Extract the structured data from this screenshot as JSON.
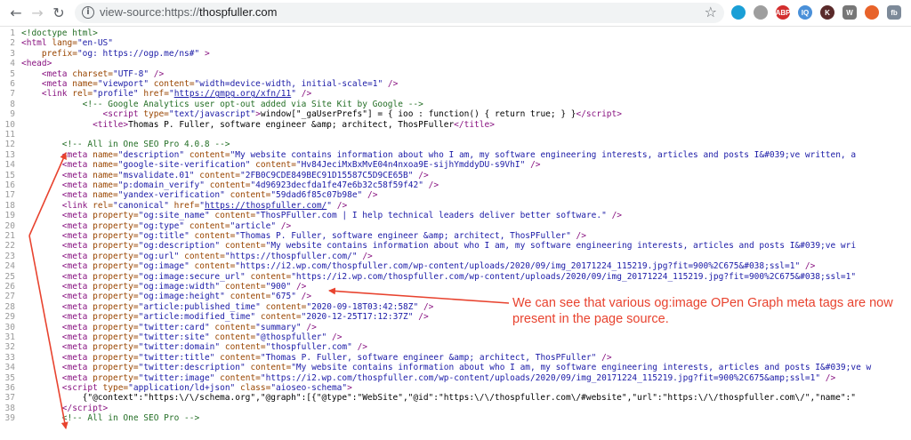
{
  "browser": {
    "url_scheme": "view-source:https://",
    "url_host": "thospfuller.com",
    "back_icon": "arrow-left",
    "forward_icon": "arrow-right",
    "reload_icon": "reload",
    "info_icon": "info-circle",
    "star_icon": "star-outline",
    "extensions": [
      {
        "name": "chat-extension-icon",
        "label": "",
        "color": "#1a9fd6"
      },
      {
        "name": "cloud-extension-icon",
        "label": "",
        "color": "#9e9e9e"
      },
      {
        "name": "adblock-icon",
        "label": "ABP",
        "color": "#d32f2f"
      },
      {
        "name": "iq-extension-icon",
        "label": "IQ",
        "color": "#4a90d9"
      },
      {
        "name": "k-extension-icon",
        "label": "K",
        "color": "#5a2a2a"
      },
      {
        "name": "wordpress-icon",
        "label": "W",
        "color": "#777777"
      },
      {
        "name": "office-icon",
        "label": "",
        "color": "#e8632a"
      },
      {
        "name": "fb-extension-icon",
        "label": "fb",
        "color": "#7d8a99"
      }
    ]
  },
  "source_lines": [
    {
      "n": "1",
      "html": "<span class=\"c\">&lt;!doctype html&gt;</span>"
    },
    {
      "n": "2",
      "html": "<span class=\"t\">&lt;html</span> <span class=\"a\">lang=</span><span class=\"v\">\"en-US\"</span>"
    },
    {
      "n": "3",
      "html": "    <span class=\"a\">prefix=</span><span class=\"v\">\"og: https://ogp.me/ns#\"</span> <span class=\"t\">&gt;</span>"
    },
    {
      "n": "4",
      "html": "<span class=\"t\">&lt;head&gt;</span>"
    },
    {
      "n": "5",
      "html": "    <span class=\"t\">&lt;meta</span> <span class=\"a\">charset=</span><span class=\"v\">\"UTF-8\"</span> <span class=\"t\">/&gt;</span>"
    },
    {
      "n": "6",
      "html": "    <span class=\"t\">&lt;meta</span> <span class=\"a\">name=</span><span class=\"v\">\"viewport\"</span> <span class=\"a\">content=</span><span class=\"v\">\"width=device-width, initial-scale=1\"</span> <span class=\"t\">/&gt;</span>"
    },
    {
      "n": "7",
      "html": "    <span class=\"t\">&lt;link</span> <span class=\"a\">rel=</span><span class=\"v\">\"profile\"</span> <span class=\"a\">href=</span><span class=\"v\">\"<span class=\"lnk\">https://gmpg.org/xfn/11</span>\"</span> <span class=\"t\">/&gt;</span>"
    },
    {
      "n": "8",
      "html": "            <span class=\"c\">&lt;!-- Google Analytics user opt-out added via Site Kit by Google --&gt;</span>"
    },
    {
      "n": "9",
      "html": "                <span class=\"t\">&lt;script</span> <span class=\"a\">type=</span><span class=\"v\">\"text/javascript\"</span><span class=\"t\">&gt;</span>window[\"_gaUserPrefs\"] = { ioo : function() { return true; } }<span class=\"t\">&lt;/script&gt;</span>"
    },
    {
      "n": "10",
      "html": "              <span class=\"t\">&lt;title&gt;</span>Thomas P. Fuller, software engineer &amp;amp; architect, ThosPFuller<span class=\"t\">&lt;/title&gt;</span>"
    },
    {
      "n": "11",
      "html": ""
    },
    {
      "n": "12",
      "html": "        <span class=\"c\">&lt;!-- All in One SEO Pro 4.0.8 --&gt;</span>"
    },
    {
      "n": "13",
      "html": "        <span class=\"t\">&lt;meta</span> <span class=\"a\">name=</span><span class=\"v\">\"description\"</span> <span class=\"a\">content=</span><span class=\"v\">\"My website contains information about who I am, my software engineering interests, articles and posts I&amp;#039;ve written, a</span>"
    },
    {
      "n": "14",
      "html": "        <span class=\"t\">&lt;meta</span> <span class=\"a\">name=</span><span class=\"v\">\"google-site-verification\"</span> <span class=\"a\">content=</span><span class=\"v\">\"Hv84JeciMxBxMvE04n4nxoa9E-sijhYmddyDU-s9VhI\"</span> <span class=\"t\">/&gt;</span>"
    },
    {
      "n": "15",
      "html": "        <span class=\"t\">&lt;meta</span> <span class=\"a\">name=</span><span class=\"v\">\"msvalidate.01\"</span> <span class=\"a\">content=</span><span class=\"v\">\"2FB0C9CDE849BEC91D15587C5D9CE65B\"</span> <span class=\"t\">/&gt;</span>"
    },
    {
      "n": "16",
      "html": "        <span class=\"t\">&lt;meta</span> <span class=\"a\">name=</span><span class=\"v\">\"p:domain_verify\"</span> <span class=\"a\">content=</span><span class=\"v\">\"4d96923decfda1fe47e6b32c58f59f42\"</span> <span class=\"t\">/&gt;</span>"
    },
    {
      "n": "17",
      "html": "        <span class=\"t\">&lt;meta</span> <span class=\"a\">name=</span><span class=\"v\">\"yandex-verification\"</span> <span class=\"a\">content=</span><span class=\"v\">\"59dad6f85c07b98e\"</span> <span class=\"t\">/&gt;</span>"
    },
    {
      "n": "18",
      "html": "        <span class=\"t\">&lt;link</span> <span class=\"a\">rel=</span><span class=\"v\">\"canonical\"</span> <span class=\"a\">href=</span><span class=\"v\">\"<span class=\"lnk\">https://thospfuller.com/</span>\"</span> <span class=\"t\">/&gt;</span>"
    },
    {
      "n": "19",
      "html": "        <span class=\"t\">&lt;meta</span> <span class=\"a\">property=</span><span class=\"v\">\"og:site_name\"</span> <span class=\"a\">content=</span><span class=\"v\">\"ThosPFuller.com | I help technical leaders deliver better software.\"</span> <span class=\"t\">/&gt;</span>"
    },
    {
      "n": "20",
      "html": "        <span class=\"t\">&lt;meta</span> <span class=\"a\">property=</span><span class=\"v\">\"og:type\"</span> <span class=\"a\">content=</span><span class=\"v\">\"article\"</span> <span class=\"t\">/&gt;</span>"
    },
    {
      "n": "21",
      "html": "        <span class=\"t\">&lt;meta</span> <span class=\"a\">property=</span><span class=\"v\">\"og:title\"</span> <span class=\"a\">content=</span><span class=\"v\">\"Thomas P. Fuller, software engineer &amp;amp; architect, ThosPFuller\"</span> <span class=\"t\">/&gt;</span>"
    },
    {
      "n": "22",
      "html": "        <span class=\"t\">&lt;meta</span> <span class=\"a\">property=</span><span class=\"v\">\"og:description\"</span> <span class=\"a\">content=</span><span class=\"v\">\"My website contains information about who I am, my software engineering interests, articles and posts I&amp;#039;ve wri</span>"
    },
    {
      "n": "23",
      "html": "        <span class=\"t\">&lt;meta</span> <span class=\"a\">property=</span><span class=\"v\">\"og:url\"</span> <span class=\"a\">content=</span><span class=\"v\">\"https://thospfuller.com/\"</span> <span class=\"t\">/&gt;</span>"
    },
    {
      "n": "24",
      "html": "        <span class=\"t\">&lt;meta</span> <span class=\"a\">property=</span><span class=\"v\">\"og:image\"</span> <span class=\"a\">content=</span><span class=\"v\">\"https://i2.wp.com/thospfuller.com/wp-content/uploads/2020/09/img_20171224_115219.jpg?fit=900%2C675&amp;#038;ssl=1\"</span> <span class=\"t\">/&gt;</span>"
    },
    {
      "n": "25",
      "html": "        <span class=\"t\">&lt;meta</span> <span class=\"a\">property=</span><span class=\"v\">\"og:image:secure_url\"</span> <span class=\"a\">content=</span><span class=\"v\">\"https://i2.wp.com/thospfuller.com/wp-content/uploads/2020/09/img_20171224_115219.jpg?fit=900%2C675&amp;#038;ssl=1\"</span>"
    },
    {
      "n": "26",
      "html": "        <span class=\"t\">&lt;meta</span> <span class=\"a\">property=</span><span class=\"v\">\"og:image:width\"</span> <span class=\"a\">content=</span><span class=\"v\">\"900\"</span> <span class=\"t\">/&gt;</span>"
    },
    {
      "n": "27",
      "html": "        <span class=\"t\">&lt;meta</span> <span class=\"a\">property=</span><span class=\"v\">\"og:image:height\"</span> <span class=\"a\">content=</span><span class=\"v\">\"675\"</span> <span class=\"t\">/&gt;</span>"
    },
    {
      "n": "28",
      "html": "        <span class=\"t\">&lt;meta</span> <span class=\"a\">property=</span><span class=\"v\">\"article:published_time\"</span> <span class=\"a\">content=</span><span class=\"v\">\"2020-09-18T03:42:58Z\"</span> <span class=\"t\">/&gt;</span>"
    },
    {
      "n": "29",
      "html": "        <span class=\"t\">&lt;meta</span> <span class=\"a\">property=</span><span class=\"v\">\"article:modified_time\"</span> <span class=\"a\">content=</span><span class=\"v\">\"2020-12-25T17:12:37Z\"</span> <span class=\"t\">/&gt;</span>"
    },
    {
      "n": "30",
      "html": "        <span class=\"t\">&lt;meta</span> <span class=\"a\">property=</span><span class=\"v\">\"twitter:card\"</span> <span class=\"a\">content=</span><span class=\"v\">\"summary\"</span> <span class=\"t\">/&gt;</span>"
    },
    {
      "n": "31",
      "html": "        <span class=\"t\">&lt;meta</span> <span class=\"a\">property=</span><span class=\"v\">\"twitter:site\"</span> <span class=\"a\">content=</span><span class=\"v\">\"@thospfuller\"</span> <span class=\"t\">/&gt;</span>"
    },
    {
      "n": "32",
      "html": "        <span class=\"t\">&lt;meta</span> <span class=\"a\">property=</span><span class=\"v\">\"twitter:domain\"</span> <span class=\"a\">content=</span><span class=\"v\">\"thospfuller.com\"</span> <span class=\"t\">/&gt;</span>"
    },
    {
      "n": "33",
      "html": "        <span class=\"t\">&lt;meta</span> <span class=\"a\">property=</span><span class=\"v\">\"twitter:title\"</span> <span class=\"a\">content=</span><span class=\"v\">\"Thomas P. Fuller, software engineer &amp;amp; architect, ThosPFuller\"</span> <span class=\"t\">/&gt;</span>"
    },
    {
      "n": "34",
      "html": "        <span class=\"t\">&lt;meta</span> <span class=\"a\">property=</span><span class=\"v\">\"twitter:description\"</span> <span class=\"a\">content=</span><span class=\"v\">\"My website contains information about who I am, my software engineering interests, articles and posts I&amp;#039;ve w</span>"
    },
    {
      "n": "35",
      "html": "        <span class=\"t\">&lt;meta</span> <span class=\"a\">property=</span><span class=\"v\">\"twitter:image\"</span> <span class=\"a\">content=</span><span class=\"v\">\"https://i2.wp.com/thospfuller.com/wp-content/uploads/2020/09/img_20171224_115219.jpg?fit=900%2C675&amp;amp;ssl=1\"</span> <span class=\"t\">/&gt;</span>"
    },
    {
      "n": "36",
      "html": "        <span class=\"t\">&lt;script</span> <span class=\"a\">type=</span><span class=\"v\">\"application/ld+json\"</span> <span class=\"a\">class=</span><span class=\"v\">\"aioseo-schema\"</span><span class=\"t\">&gt;</span>"
    },
    {
      "n": "37",
      "html": "            {\"@context\":\"https:\\/\\/schema.org\",\"@graph\":[{\"@type\":\"WebSite\",\"@id\":\"https:\\/\\/thospfuller.com\\/#website\",\"url\":\"https:\\/\\/thospfuller.com\\/\",\"name\":\""
    },
    {
      "n": "38",
      "html": "        <span class=\"t\">&lt;/script&gt;</span>"
    },
    {
      "n": "39",
      "html": "        <span class=\"c\">&lt;!-- All in One SEO Pro --&gt;</span>"
    }
  ],
  "annotation": {
    "text": "We can see that various og:image OPen Graph meta tags are now present in the page source.",
    "color": "#e8432f"
  }
}
